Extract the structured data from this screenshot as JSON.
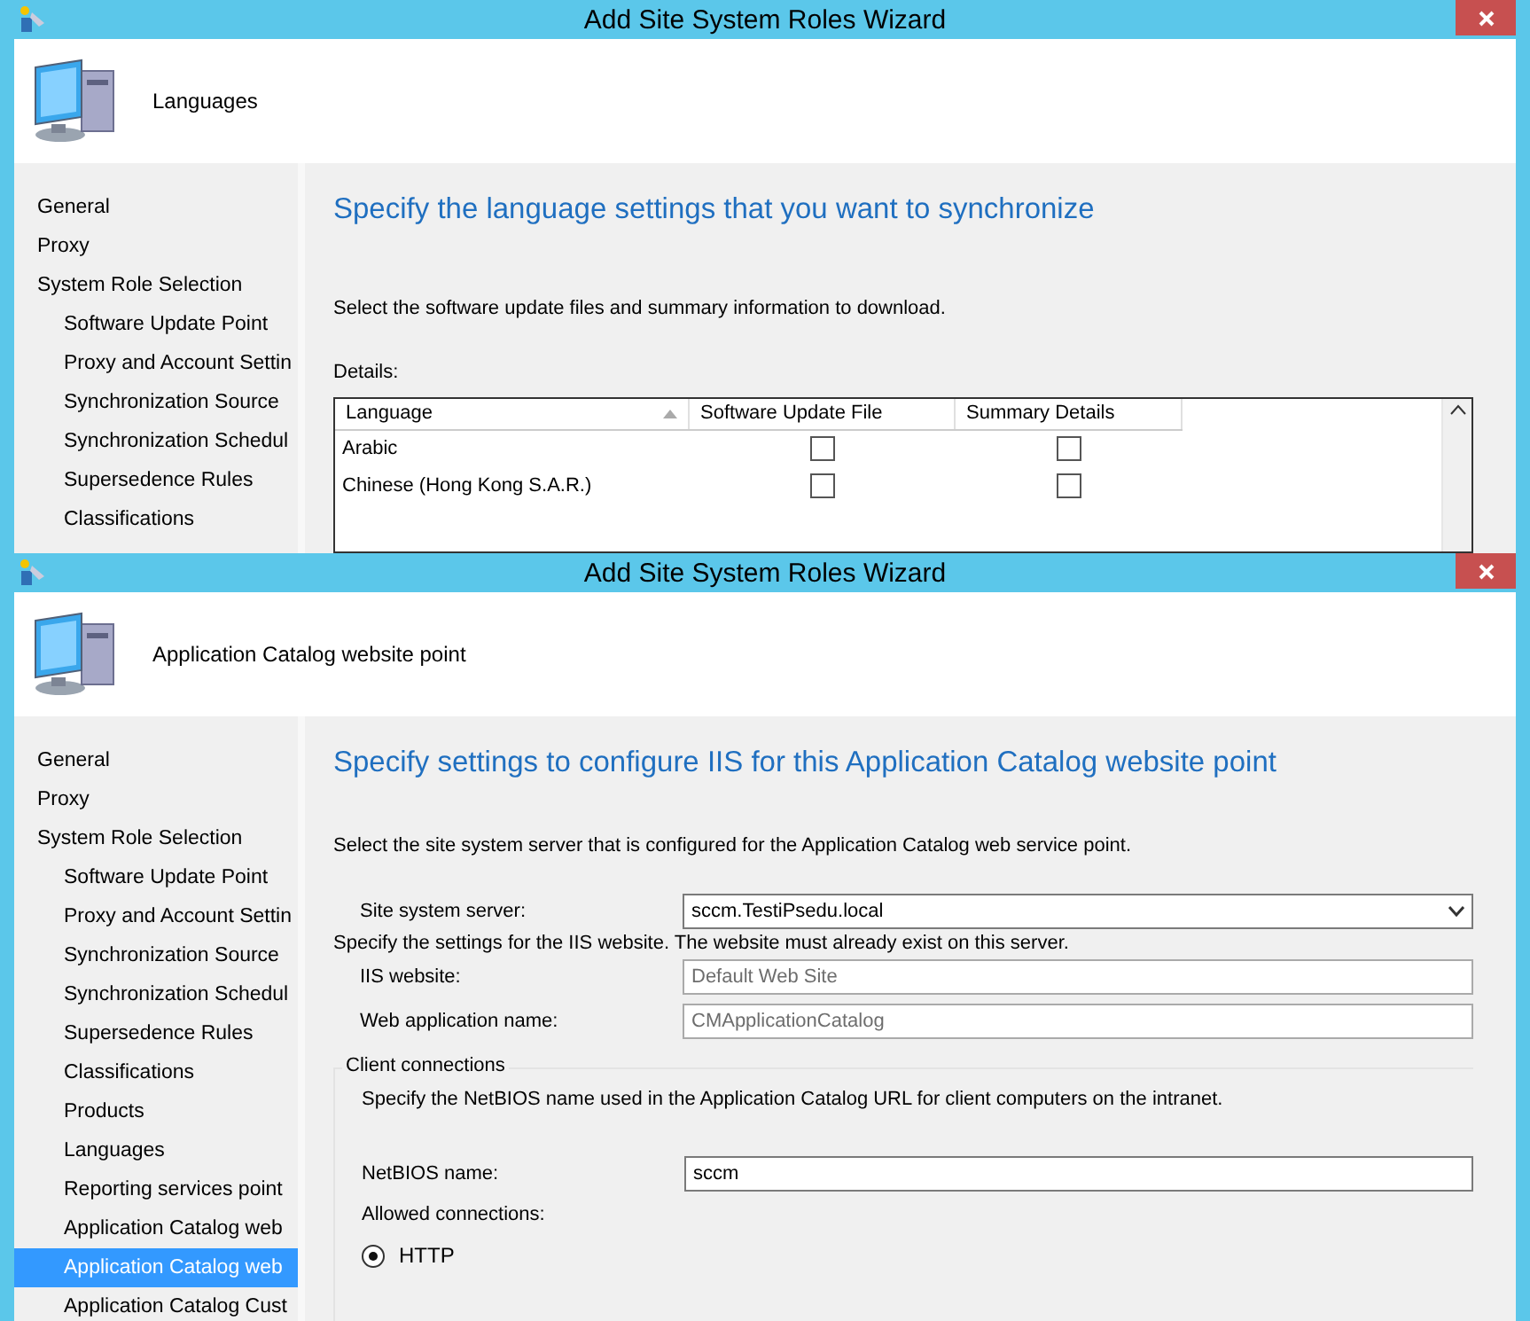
{
  "windows": [
    {
      "kind": "languages",
      "title": "Add Site System Roles Wizard",
      "page_title": "Languages",
      "nav": [
        {
          "label": "General",
          "selected": false
        },
        {
          "label": "Proxy",
          "selected": false
        },
        {
          "label": "System Role Selection",
          "selected": false,
          "children": [
            {
              "label": "Software Update Point",
              "selected": false
            },
            {
              "label": "Proxy and Account Settin",
              "selected": false
            },
            {
              "label": "Synchronization Source",
              "selected": false
            },
            {
              "label": "Synchronization Schedul",
              "selected": false
            },
            {
              "label": "Supersedence Rules",
              "selected": false
            },
            {
              "label": "Classifications",
              "selected": false
            }
          ]
        }
      ],
      "heading": "Specify the language settings that you want to synchronize",
      "instruction": "Select the software update files and summary information to download.",
      "details_label": "Details:",
      "table": {
        "columns": [
          "Language",
          "Software Update File",
          "Summary Details"
        ],
        "rows": [
          {
            "language": "Arabic",
            "update_file": false,
            "summary": false
          },
          {
            "language": "Chinese (Hong Kong S.A.R.)",
            "update_file": false,
            "summary": false
          }
        ]
      }
    },
    {
      "kind": "iis",
      "title": "Add Site System Roles Wizard",
      "page_title": "Application Catalog website point",
      "nav": [
        {
          "label": "General",
          "selected": false
        },
        {
          "label": "Proxy",
          "selected": false
        },
        {
          "label": "System Role Selection",
          "selected": false,
          "children": [
            {
              "label": "Software Update Point",
              "selected": false
            },
            {
              "label": "Proxy and Account Settin",
              "selected": false
            },
            {
              "label": "Synchronization Source",
              "selected": false
            },
            {
              "label": "Synchronization Schedul",
              "selected": false
            },
            {
              "label": "Supersedence Rules",
              "selected": false
            },
            {
              "label": "Classifications",
              "selected": false
            },
            {
              "label": "Products",
              "selected": false
            },
            {
              "label": "Languages",
              "selected": false
            },
            {
              "label": "Reporting services point",
              "selected": false
            },
            {
              "label": "Application Catalog web",
              "selected": false
            },
            {
              "label": "Application Catalog web",
              "selected": true
            },
            {
              "label": "Application Catalog Cust",
              "selected": false
            }
          ]
        }
      ],
      "heading": "Specify settings to configure IIS for this Application Catalog website point",
      "instruction": "Select the site system server that is configured for the Application Catalog web service point.",
      "server": {
        "label": "Site system server:",
        "value": "sccm.TestiPsedu.local"
      },
      "iis_note": "Specify the settings for the IIS website. The website must already exist on this server.",
      "iis_fields": [
        {
          "label": "IIS website:",
          "value": "Default Web Site",
          "disabled": true
        },
        {
          "label": "Web application name:",
          "value": "CMApplicationCatalog",
          "disabled": true
        }
      ],
      "client_group": {
        "title": "Client connections",
        "note": "Specify the NetBIOS name used in the Application Catalog URL for client computers on the intranet.",
        "netbios": {
          "label": "NetBIOS name:",
          "value": "sccm"
        },
        "allowed_label": "Allowed connections:",
        "options": [
          {
            "label": "HTTP",
            "selected": true
          }
        ]
      }
    }
  ]
}
